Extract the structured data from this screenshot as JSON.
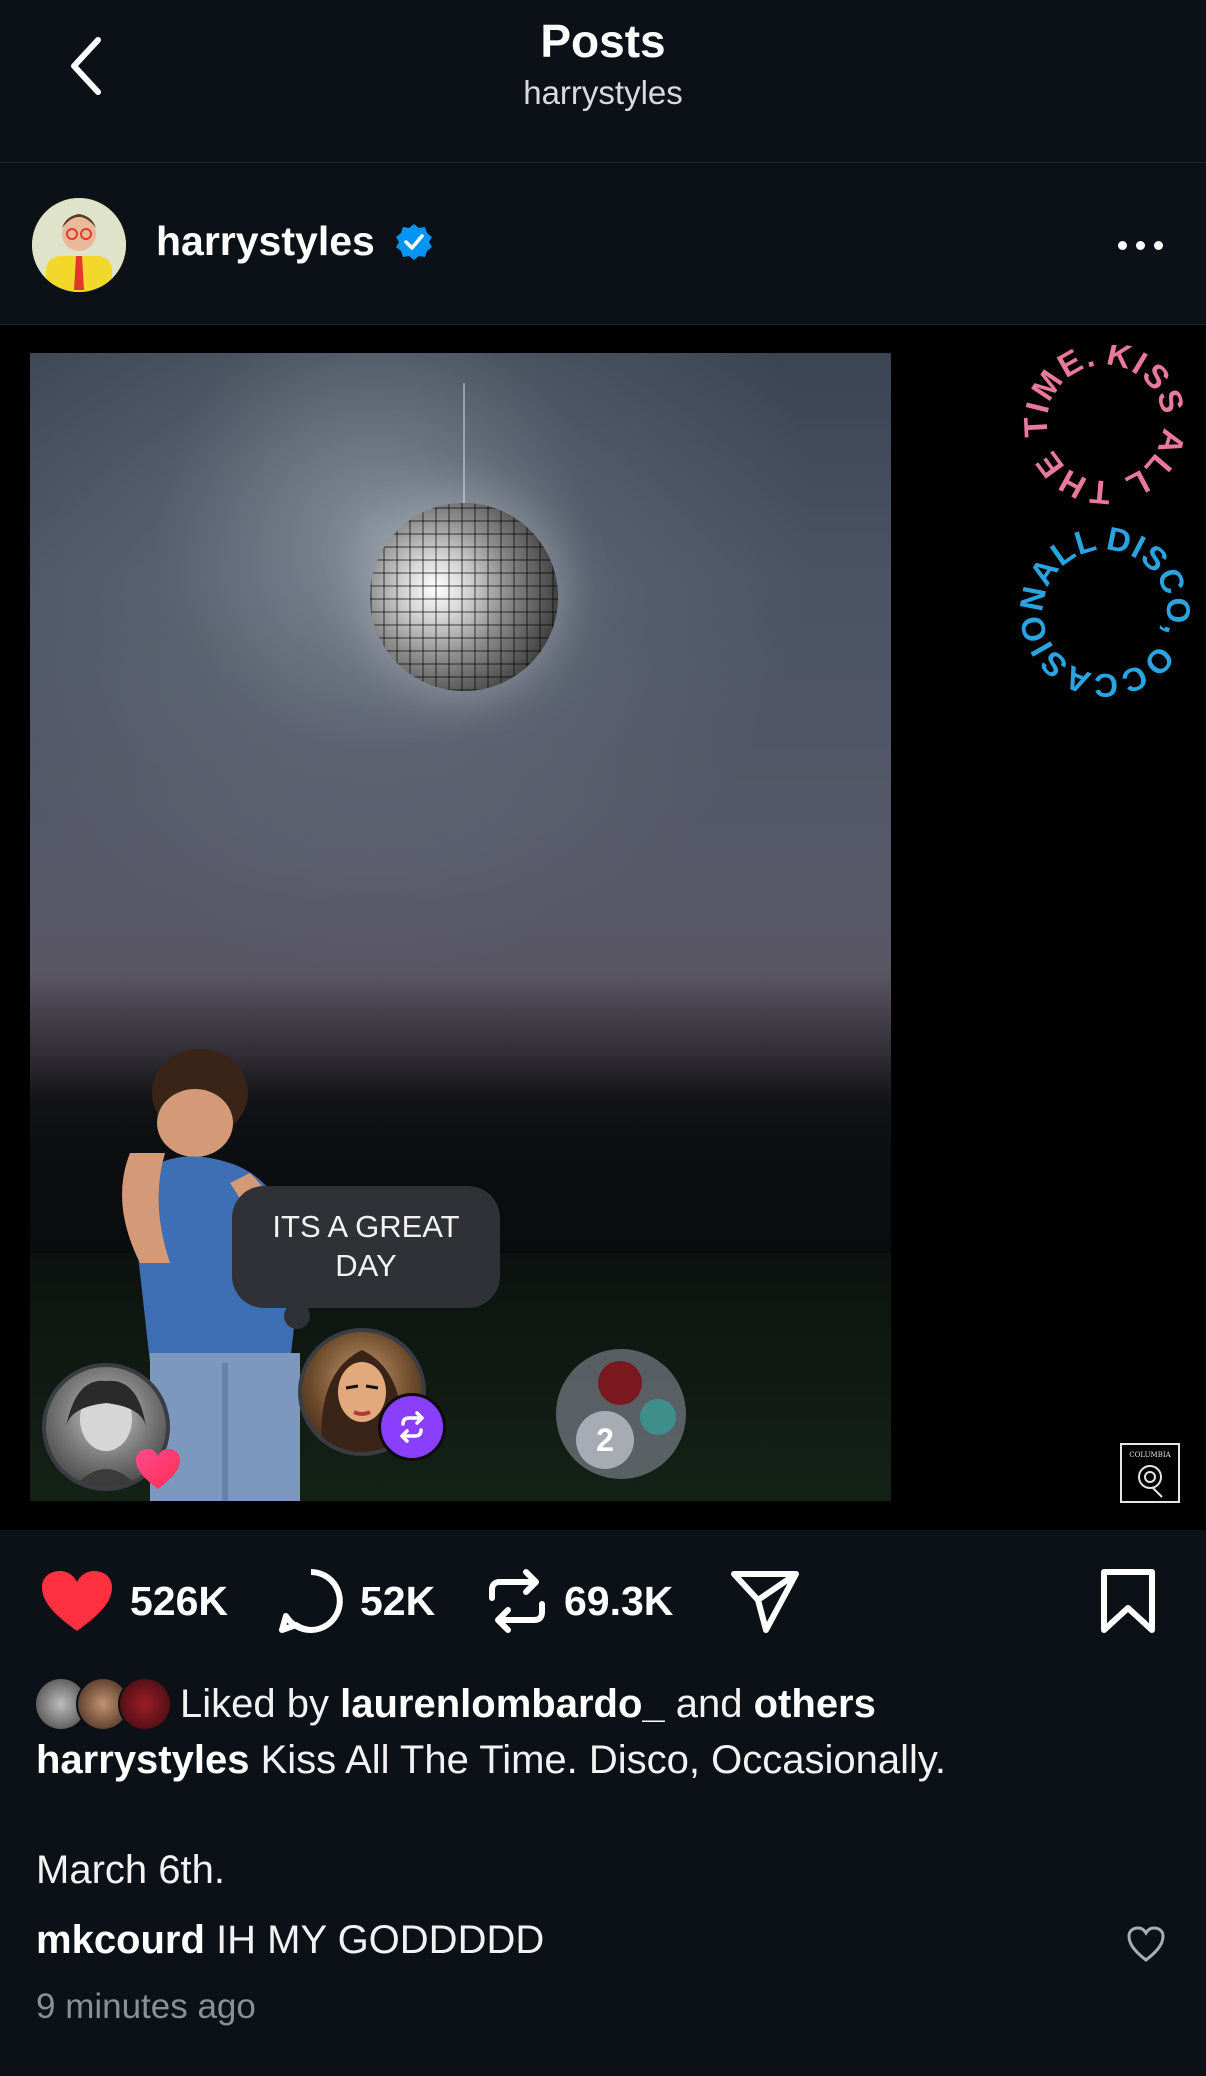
{
  "header": {
    "title": "Posts",
    "subtitle": "harrystyles"
  },
  "post": {
    "username": "harrystyles",
    "verified": true,
    "media": {
      "sticker_text": "ITS A GREAT DAY",
      "group_count": "2",
      "spiral_text_1": "KISS ALL THE TIME.",
      "spiral_text_2": "DISCO, OCCASIONALLY.",
      "logo_text": "COLUMBIA"
    },
    "actions": {
      "likes": "526K",
      "comments": "52K",
      "reposts": "69.3K"
    },
    "liked_by": {
      "prefix": "Liked by",
      "user": "laurenlombardo_",
      "and": "and",
      "others": "others"
    },
    "caption": {
      "username": "harrystyles",
      "text": "Kiss All The Time. Disco, Occasionally.",
      "line2": "March 6th."
    },
    "comment": {
      "username": "mkcourd",
      "text": "IH MY GODDDDD"
    },
    "timestamp": "9 minutes ago"
  },
  "colors": {
    "background": "#0c1017",
    "like_red": "#ff3040",
    "verified_blue": "#0095f6",
    "repost_purple": "#8a3ffc",
    "spiral_pink": "#e8799d",
    "spiral_blue": "#2aa4e0"
  },
  "icons": {
    "back": "chevron-left-icon",
    "verified": "verified-badge-icon",
    "more": "more-horizontal-icon",
    "like": "heart-icon",
    "comment": "comment-icon",
    "repost": "repost-icon",
    "share": "send-icon",
    "save": "bookmark-icon"
  }
}
